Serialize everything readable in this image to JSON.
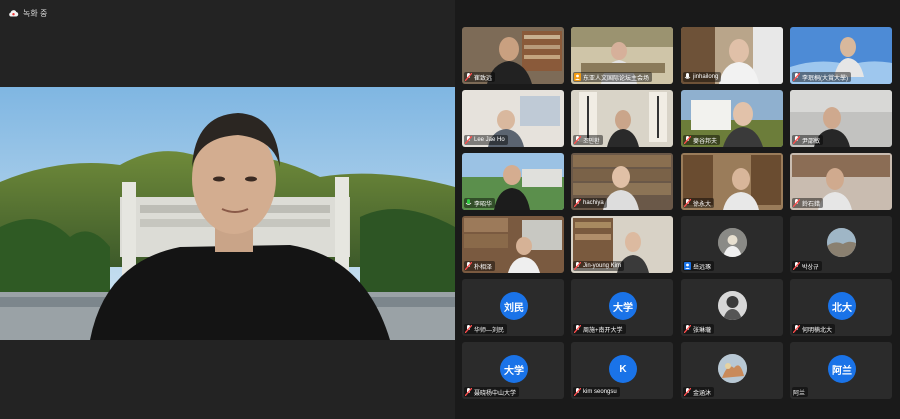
{
  "recording": {
    "label": "녹화 중"
  },
  "colors": {
    "accent": "#1a73e8",
    "background": "#202020",
    "tile": "#2b2b2b",
    "mic_muted": "#ff4d4d"
  },
  "tiles": [
    {
      "name": "崔致远",
      "icon": "mic-muted-icon"
    },
    {
      "name": "东亚人文国际论坛主会场",
      "icon": "person-icon"
    },
    {
      "name": "jinhailong",
      "icon": "mic-icon"
    },
    {
      "name": "李珉桐(大賞大學)",
      "icon": "mic-muted-icon"
    },
    {
      "name": "Lee Jae Ho",
      "icon": "mic-muted-icon"
    },
    {
      "name": "조민환",
      "icon": "mic-muted-icon"
    },
    {
      "name": "麥谷邦夫",
      "icon": "mic-muted-icon"
    },
    {
      "name": "尹邵敏",
      "icon": "mic-muted-icon"
    },
    {
      "name": "李昭华",
      "icon": "mic-icon"
    },
    {
      "name": "hachiya",
      "icon": "mic-muted-icon"
    },
    {
      "name": "徐永大",
      "icon": "mic-muted-icon"
    },
    {
      "name": "鈴石錯",
      "icon": "mic-muted-icon"
    },
    {
      "name": "朴相泽",
      "icon": "mic-muted-icon"
    },
    {
      "name": "Jin-young Kim",
      "icon": "mic-muted-icon"
    },
    {
      "name": "岳远琢",
      "icon": "person-icon",
      "avatar": "photo"
    },
    {
      "name": "박상규",
      "icon": "mic-muted-icon",
      "avatar": "photo"
    },
    {
      "name": "华师—刘民",
      "icon": "mic-muted-icon",
      "avatar_text": "刘民"
    },
    {
      "name": "周施+南开大学",
      "icon": "mic-muted-icon",
      "avatar_text": "大学"
    },
    {
      "name": "张琳瓏",
      "icon": "mic-muted-icon",
      "avatar": "photo"
    },
    {
      "name": "何明楠北大",
      "icon": "mic-muted-icon",
      "avatar_text": "北大"
    },
    {
      "name": "聂晓杨中山大学",
      "icon": "mic-muted-icon",
      "avatar_text": "大学"
    },
    {
      "name": "kim seongsu",
      "icon": "mic-muted-icon",
      "avatar_text": "K"
    },
    {
      "name": "金涵沐",
      "icon": "mic-muted-icon",
      "avatar": "photo"
    },
    {
      "name": "阿兰",
      "icon": "none",
      "avatar_text": "阿兰"
    }
  ]
}
